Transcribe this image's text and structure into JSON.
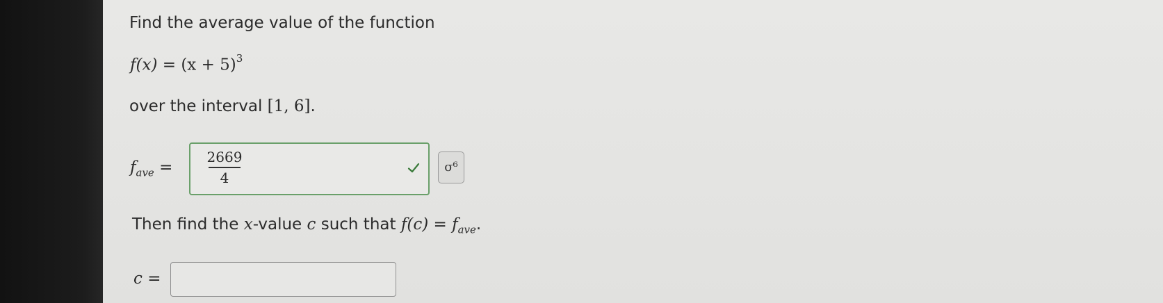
{
  "question": {
    "intro": "Find the average value of the function",
    "function_lhs": "f(x) = ",
    "function_base": "(x + 5)",
    "function_exp": "3",
    "interval_text": "over the interval ",
    "interval": "[1, 6]",
    "interval_end": ".",
    "fave_label_f": "f",
    "fave_label_sub": "ave",
    "equals": " =",
    "then_text_1": "Then find the ",
    "then_var": "x",
    "then_text_2": "-value ",
    "then_c": "c",
    "then_text_3": " such that ",
    "then_expr": "f(c) = f",
    "then_sub": "ave",
    "then_end": ".",
    "c_label": "c ="
  },
  "answer_fave": {
    "numerator": "2669",
    "denominator": "4",
    "status": "correct",
    "status_color": "#3a7a3a"
  },
  "symbol_button": {
    "label": "σ⁶"
  },
  "answer_c": {
    "value": ""
  }
}
